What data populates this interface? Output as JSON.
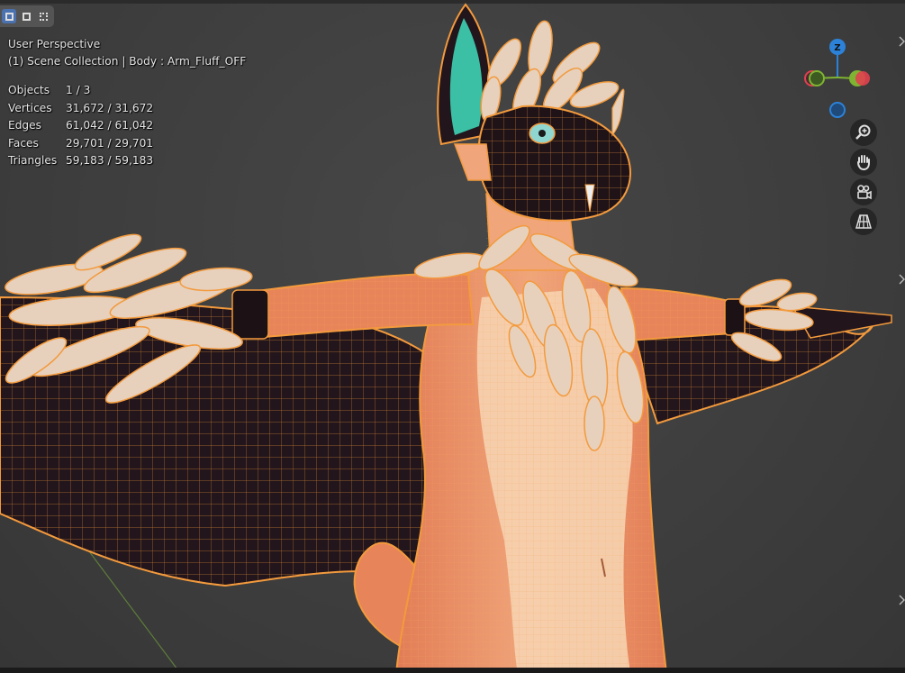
{
  "viewport": {
    "view_name": "User Perspective",
    "collection_info": "(1) Scene Collection | Body : Arm_Fluff_OFF",
    "stats": [
      {
        "label": "Objects",
        "value": "1 / 3"
      },
      {
        "label": "Vertices",
        "value": "31,672 / 31,672"
      },
      {
        "label": "Edges",
        "value": "61,042 / 61,042"
      },
      {
        "label": "Faces",
        "value": "29,701 / 29,701"
      },
      {
        "label": "Triangles",
        "value": "59,183 / 59,183"
      }
    ]
  },
  "gizmo": {
    "z_label": "Z",
    "colors": {
      "x": "#e0414f",
      "y": "#7fb332",
      "z": "#2c82d9"
    }
  },
  "nav_buttons": [
    {
      "icon": "zoom-icon"
    },
    {
      "icon": "hand-pan-icon"
    },
    {
      "icon": "camera-icon"
    },
    {
      "icon": "grid-perspective-icon"
    }
  ],
  "colors": {
    "wire_orange": "#f0963a",
    "skin": "#e88459",
    "dark_membrane": "#20141a",
    "fluff": "#e7d1bd",
    "ear_teal": "#3bbfa5"
  }
}
